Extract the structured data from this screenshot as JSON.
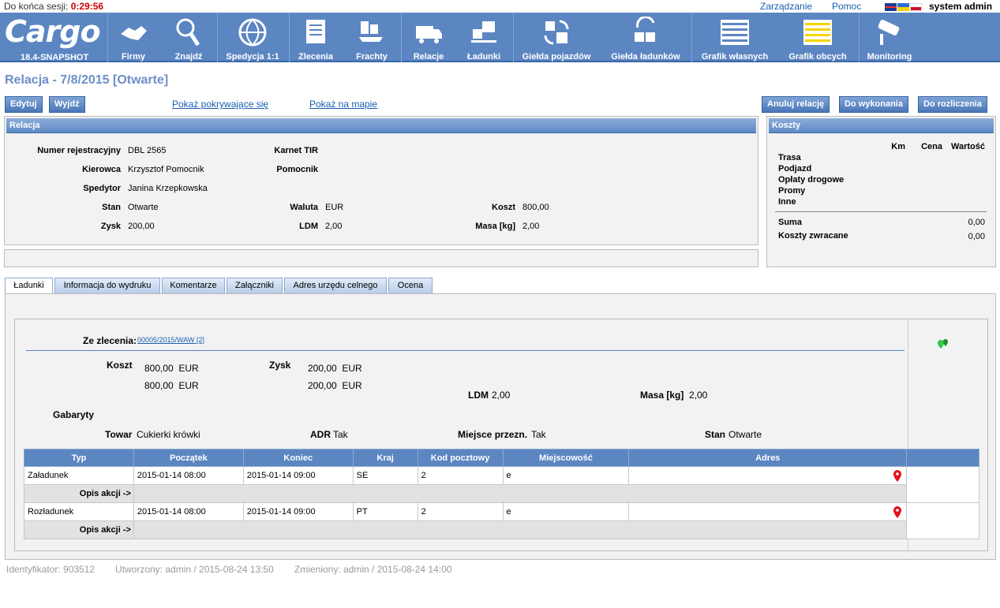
{
  "top": {
    "session_label": "Do końca sesji:",
    "session_time": "0:29:56",
    "manage": "Zarządzanie",
    "help": "Pomoc",
    "user": "system admin"
  },
  "nav": {
    "logo": "Cargo",
    "version": "18.4-SNAPSHOT",
    "items": [
      "Firmy",
      "Znajdź",
      "Spedycja 1:1",
      "Zlecenia",
      "Frachty",
      "Relacje",
      "Ładunki",
      "Giełda pojazdów",
      "Giełda ładunków",
      "Grafik własnych",
      "Grafik obcych",
      "Monitoring"
    ]
  },
  "title": "Relacja - 7/8/2015 [Otwarte]",
  "buttons": {
    "edit": "Edytuj",
    "exit": "Wyjdź",
    "cancel": "Anuluj relację",
    "todo": "Do wykonania",
    "settle": "Do rozliczenia"
  },
  "links": {
    "overlap": "Pokaż pokrywające się",
    "map": "Pokaż na mapie"
  },
  "relacja": {
    "header": "Relacja",
    "reg_label": "Numer rejestracyjny",
    "reg": "DBL 2565",
    "tir_label": "Karnet TIR",
    "driver_label": "Kierowca",
    "driver": "Krzysztof Pomocnik",
    "helper_label": "Pomocnik",
    "forwarder_label": "Spedytor",
    "forwarder": "Janina Krzepkowska",
    "state_label": "Stan",
    "state": "Otwarte",
    "currency_label": "Waluta",
    "currency": "EUR",
    "cost_label": "Koszt",
    "cost": "800,00",
    "profit_label": "Zysk",
    "profit": "200,00",
    "ldm_label": "LDM",
    "ldm": "2,00",
    "mass_label": "Masa [kg]",
    "mass": "2,00"
  },
  "koszty": {
    "header": "Koszty",
    "col_km": "Km",
    "col_price": "Cena",
    "col_value": "Wartość",
    "rows": [
      "Trasa",
      "Podjazd",
      "Opłaty drogowe",
      "Promy",
      "Inne"
    ],
    "sum_label": "Suma",
    "sum": "0,00",
    "refund_label": "Koszty zwracane",
    "refund": "0,00"
  },
  "tabs": [
    "Ładunki",
    "Informacja do wydruku",
    "Komentarze",
    "Załączniki",
    "Adres urzędu celnego",
    "Ocena"
  ],
  "load": {
    "order_label": "Ze zlecenia:",
    "order": "00005/2015/WAW [2]",
    "cost_label": "Koszt",
    "cost1": "800,00  EUR",
    "cost2": "800,00  EUR",
    "profit_label": "Zysk",
    "profit1": "200,00  EUR",
    "profit2": "200,00  EUR",
    "ldm_label": "LDM",
    "ldm": "2,00",
    "mass_label": "Masa [kg]",
    "mass": "2,00",
    "dims_label": "Gabaryty",
    "goods_label": "Towar",
    "goods": "Cukierki krówki",
    "adr_label": "ADR",
    "adr": "Tak",
    "place_label": "Miejsce przezn.",
    "place": "Tak",
    "state_label": "Stan",
    "state": "Otwarte"
  },
  "table": {
    "headers": [
      "Typ",
      "Początek",
      "Koniec",
      "Kraj",
      "Kod pocztowy",
      "Miejscowość",
      "Adres"
    ],
    "opis": "Opis akcji ->",
    "rows": [
      {
        "typ": "Załadunek",
        "start": "2015-01-14 08:00",
        "end": "2015-01-14 09:00",
        "country": "SE",
        "zip": "2",
        "city": "e",
        "addr": ""
      },
      {
        "typ": "Rozładunek",
        "start": "2015-01-14 08:00",
        "end": "2015-01-14 09:00",
        "country": "PT",
        "zip": "2",
        "city": "e",
        "addr": ""
      }
    ]
  },
  "footer": {
    "id": "Identyfikator: 903512",
    "created": "Utworzony: admin / 2015-08-24 13:50",
    "changed": "Zmieniony: admin / 2015-08-24 14:00"
  }
}
